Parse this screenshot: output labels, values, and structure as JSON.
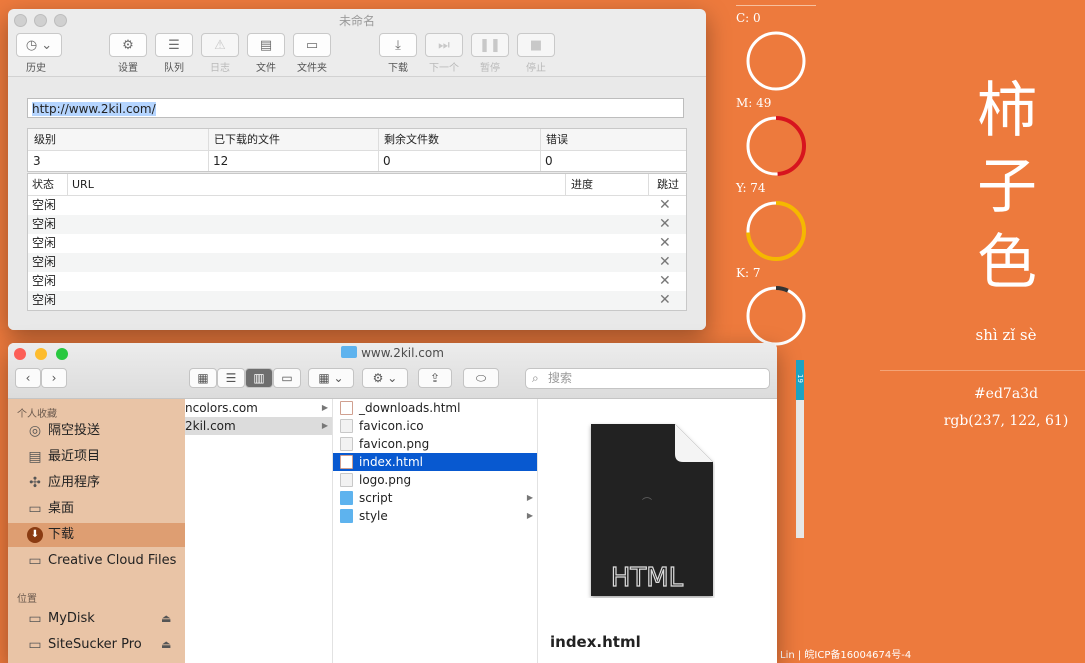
{
  "website": {
    "cmyk": [
      {
        "label": "C: 0",
        "value": 0,
        "color": "#ffffff"
      },
      {
        "label": "M: 49",
        "value": 49,
        "color": "#d7141e"
      },
      {
        "label": "Y: 74",
        "value": 74,
        "color": "#f5b800"
      },
      {
        "label": "K: 7",
        "value": 7,
        "color": "#333333"
      }
    ],
    "vertical_bar_value": "19",
    "characters": [
      "柿",
      "子",
      "色"
    ],
    "pinyin": "shì zǐ sè",
    "hex": "#ed7a3d",
    "rgb": "rgb(237, 122, 61)",
    "footer": "Lin | 皖ICP备16004674号-4",
    "bg_color": "#ed7a3d"
  },
  "sitesucker": {
    "title": "未命名",
    "toolbar": [
      {
        "label": "历史",
        "icon": "clock-icon",
        "enabled": true
      },
      {
        "label": "设置",
        "icon": "gear-icon",
        "enabled": true
      },
      {
        "label": "队列",
        "icon": "list-icon",
        "enabled": true
      },
      {
        "label": "日志",
        "icon": "warning-icon",
        "enabled": false
      },
      {
        "label": "文件",
        "icon": "document-icon",
        "enabled": true
      },
      {
        "label": "文件夹",
        "icon": "folder-icon",
        "enabled": true
      },
      {
        "label": "下载",
        "icon": "download-icon",
        "enabled": true
      },
      {
        "label": "下一个",
        "icon": "next-icon",
        "enabled": false
      },
      {
        "label": "暂停",
        "icon": "pause-icon",
        "enabled": false
      },
      {
        "label": "停止",
        "icon": "stop-icon",
        "enabled": false
      }
    ],
    "url": "http://www.2kil.com/",
    "stats_headers": [
      "级别",
      "已下载的文件",
      "剩余文件数",
      "错误"
    ],
    "stats_values": [
      "3",
      "12",
      "0",
      "0"
    ],
    "queue_headers": {
      "status": "状态",
      "url": "URL",
      "progress": "进度",
      "skip": "跳过"
    },
    "queue_rows": [
      {
        "status": "空闲",
        "url": "",
        "progress": ""
      },
      {
        "status": "空闲",
        "url": "",
        "progress": ""
      },
      {
        "status": "空闲",
        "url": "",
        "progress": ""
      },
      {
        "status": "空闲",
        "url": "",
        "progress": ""
      },
      {
        "status": "空闲",
        "url": "",
        "progress": ""
      },
      {
        "status": "空闲",
        "url": "",
        "progress": ""
      }
    ]
  },
  "finder": {
    "title": "www.2kil.com",
    "search_placeholder": "搜索",
    "sidebar": {
      "favorites_heading": "个人收藏",
      "favorites": [
        {
          "label": "隔空投送",
          "icon": "airdrop-icon",
          "selected": false
        },
        {
          "label": "最近项目",
          "icon": "recents-icon",
          "selected": false
        },
        {
          "label": "应用程序",
          "icon": "applications-icon",
          "selected": false
        },
        {
          "label": "桌面",
          "icon": "desktop-icon",
          "selected": false
        },
        {
          "label": "下载",
          "icon": "downloads-icon",
          "selected": true
        },
        {
          "label": "Creative Cloud Files",
          "icon": "folder-icon",
          "selected": false
        }
      ],
      "locations_heading": "位置",
      "locations": [
        {
          "label": "MyDisk",
          "icon": "disk-icon"
        },
        {
          "label": "SiteSucker Pro",
          "icon": "disk-icon"
        }
      ]
    },
    "column1": [
      {
        "name": "ncolors.com",
        "has_children": true,
        "state": "none"
      },
      {
        "name": "2kil.com",
        "has_children": true,
        "state": "gray"
      }
    ],
    "column2": [
      {
        "name": "_downloads.html",
        "type": "html",
        "has_children": false,
        "state": "none"
      },
      {
        "name": "favicon.ico",
        "type": "image",
        "has_children": false,
        "state": "none"
      },
      {
        "name": "favicon.png",
        "type": "image",
        "has_children": false,
        "state": "none"
      },
      {
        "name": "index.html",
        "type": "html",
        "has_children": false,
        "state": "blue"
      },
      {
        "name": "logo.png",
        "type": "image",
        "has_children": false,
        "state": "none"
      },
      {
        "name": "script",
        "type": "folder",
        "has_children": true,
        "state": "none"
      },
      {
        "name": "style",
        "type": "folder",
        "has_children": true,
        "state": "none"
      }
    ],
    "preview": {
      "badge": "HTML",
      "filename": "index.html"
    }
  }
}
